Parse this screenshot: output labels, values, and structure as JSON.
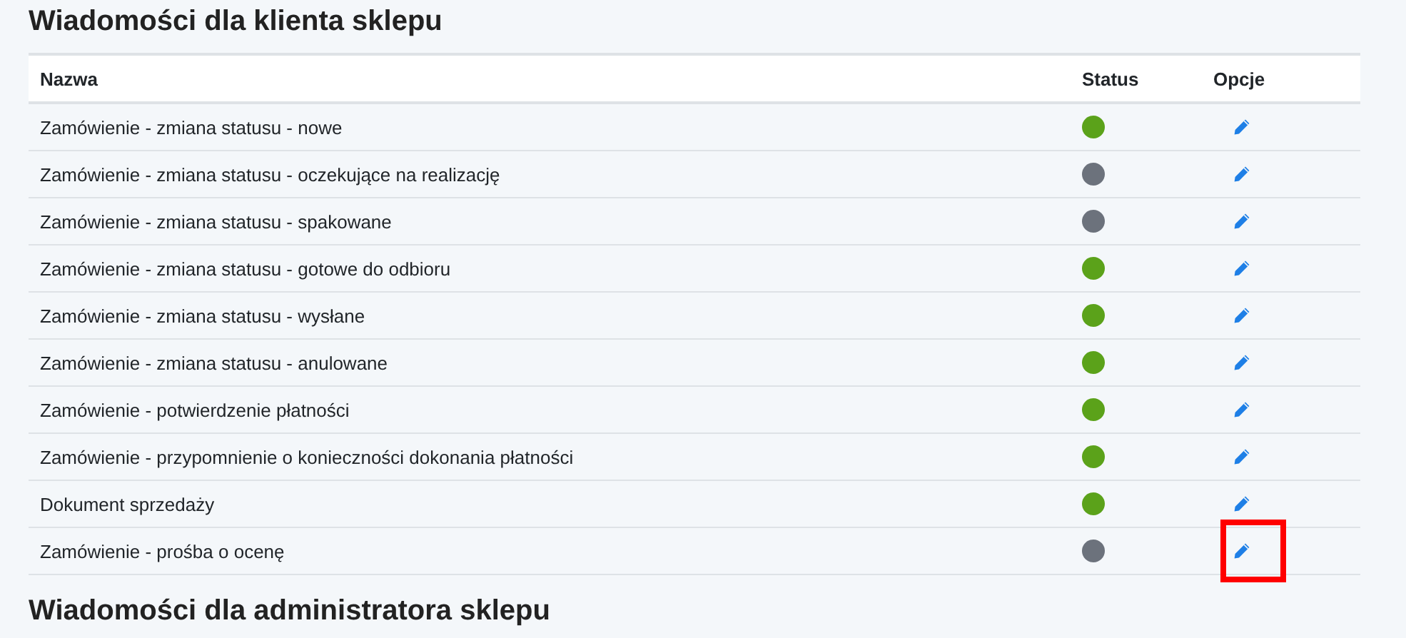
{
  "sections": [
    {
      "title": "Wiadomości dla klienta sklepu",
      "table": {
        "columns": [
          "Nazwa",
          "Status",
          "Opcje"
        ],
        "rows": [
          {
            "name": "Zamówienie - zmiana statusu - nowe",
            "active": true,
            "highlighted": false
          },
          {
            "name": "Zamówienie - zmiana statusu - oczekujące na realizację",
            "active": false,
            "highlighted": false
          },
          {
            "name": "Zamówienie - zmiana statusu - spakowane",
            "active": false,
            "highlighted": false
          },
          {
            "name": "Zamówienie - zmiana statusu - gotowe do odbioru",
            "active": true,
            "highlighted": false
          },
          {
            "name": "Zamówienie - zmiana statusu - wysłane",
            "active": true,
            "highlighted": false
          },
          {
            "name": "Zamówienie - zmiana statusu - anulowane",
            "active": true,
            "highlighted": false
          },
          {
            "name": "Zamówienie - potwierdzenie płatności",
            "active": true,
            "highlighted": false
          },
          {
            "name": "Zamówienie - przypomnienie o konieczności dokonania płatności",
            "active": true,
            "highlighted": false
          },
          {
            "name": "Dokument sprzedaży",
            "active": true,
            "highlighted": false
          },
          {
            "name": "Zamówienie - prośba o ocenę",
            "active": false,
            "highlighted": true
          }
        ]
      }
    },
    {
      "title": "Wiadomości dla administratora sklepu"
    }
  ]
}
